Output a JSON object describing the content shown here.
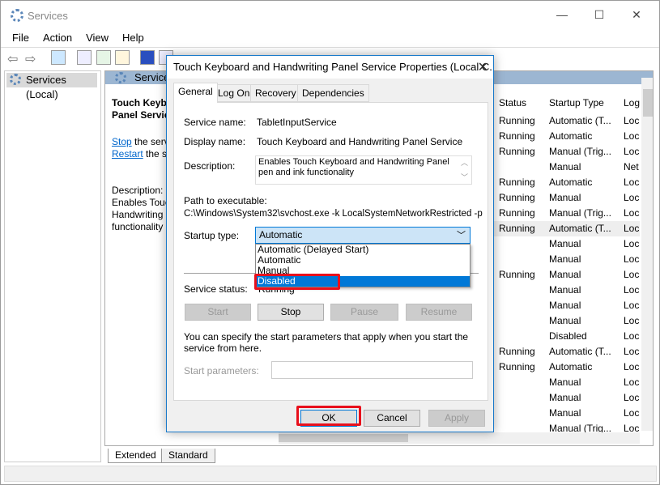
{
  "window": {
    "title": "Services",
    "minimize": "—",
    "maximize": "☐",
    "close": "✕"
  },
  "menu": [
    "File",
    "Action",
    "View",
    "Help"
  ],
  "tree": {
    "item": "Services (Local)"
  },
  "main": {
    "header": "Services",
    "service_title_1": "Touch Keyb",
    "service_title_2": "Panel Servic",
    "stop_link": "Stop",
    "stop_rest": " the serv",
    "restart_link": "Restart",
    "restart_rest": " the se",
    "desc_label": "Description:",
    "desc_1": "Enables Touc",
    "desc_2": "Handwriting",
    "desc_3": "functionality",
    "columns": [
      "Status",
      "Startup Type",
      "Log"
    ],
    "rows": [
      [
        "Running",
        "Automatic (T...",
        "Loc"
      ],
      [
        "Running",
        "Automatic",
        "Loc"
      ],
      [
        "Running",
        "Manual (Trig...",
        "Loc"
      ],
      [
        "",
        "Manual",
        "Net"
      ],
      [
        "Running",
        "Automatic",
        "Loc"
      ],
      [
        "Running",
        "Manual",
        "Loc"
      ],
      [
        "Running",
        "Manual (Trig...",
        "Loc"
      ],
      [
        "Running",
        "Automatic (T...",
        "Loc"
      ],
      [
        "",
        "Manual",
        "Loc"
      ],
      [
        "",
        "Manual",
        "Loc"
      ],
      [
        "Running",
        "Manual",
        "Loc"
      ],
      [
        "",
        "Manual",
        "Loc"
      ],
      [
        "",
        "Manual",
        "Loc"
      ],
      [
        "",
        "Manual",
        "Loc"
      ],
      [
        "",
        "Disabled",
        "Loc"
      ],
      [
        "Running",
        "Automatic (T...",
        "Loc"
      ],
      [
        "Running",
        "Automatic",
        "Loc"
      ],
      [
        "",
        "Manual",
        "Loc"
      ],
      [
        "",
        "Manual",
        "Loc"
      ],
      [
        "",
        "Manual",
        "Loc"
      ],
      [
        "",
        "Manual (Trig...",
        "Loc"
      ]
    ],
    "highlighted_row": 8
  },
  "bottom_tabs": [
    "Extended",
    "Standard"
  ],
  "dialog": {
    "title": "Touch Keyboard and Handwriting Panel Service Properties (Local C...",
    "close": "✕",
    "tabs": [
      "General",
      "Log On",
      "Recovery",
      "Dependencies"
    ],
    "service_name_label": "Service name:",
    "service_name": "TabletInputService",
    "display_name_label": "Display name:",
    "display_name": "Touch Keyboard and Handwriting Panel Service",
    "description_label": "Description:",
    "description": "Enables Touch Keyboard and Handwriting Panel pen and ink functionality",
    "path_label": "Path to executable:",
    "path": "C:\\Windows\\System32\\svchost.exe -k LocalSystemNetworkRestricted -p",
    "startup_label": "Startup type:",
    "startup_value": "Automatic",
    "startup_options": [
      "Automatic (Delayed Start)",
      "Automatic",
      "Manual",
      "Disabled"
    ],
    "startup_highlighted": "Disabled",
    "status_label": "Service status:",
    "status_value": "Running",
    "start": "Start",
    "stop": "Stop",
    "pause": "Pause",
    "resume": "Resume",
    "hint": "You can specify the start parameters that apply when you start the service from here.",
    "params_label": "Start parameters:",
    "params_value": "",
    "ok": "OK",
    "cancel": "Cancel",
    "apply": "Apply"
  },
  "colors": {
    "accent": "#0078d7",
    "highlight_box": "#e8101c",
    "header_band": "#9cb6d2"
  }
}
